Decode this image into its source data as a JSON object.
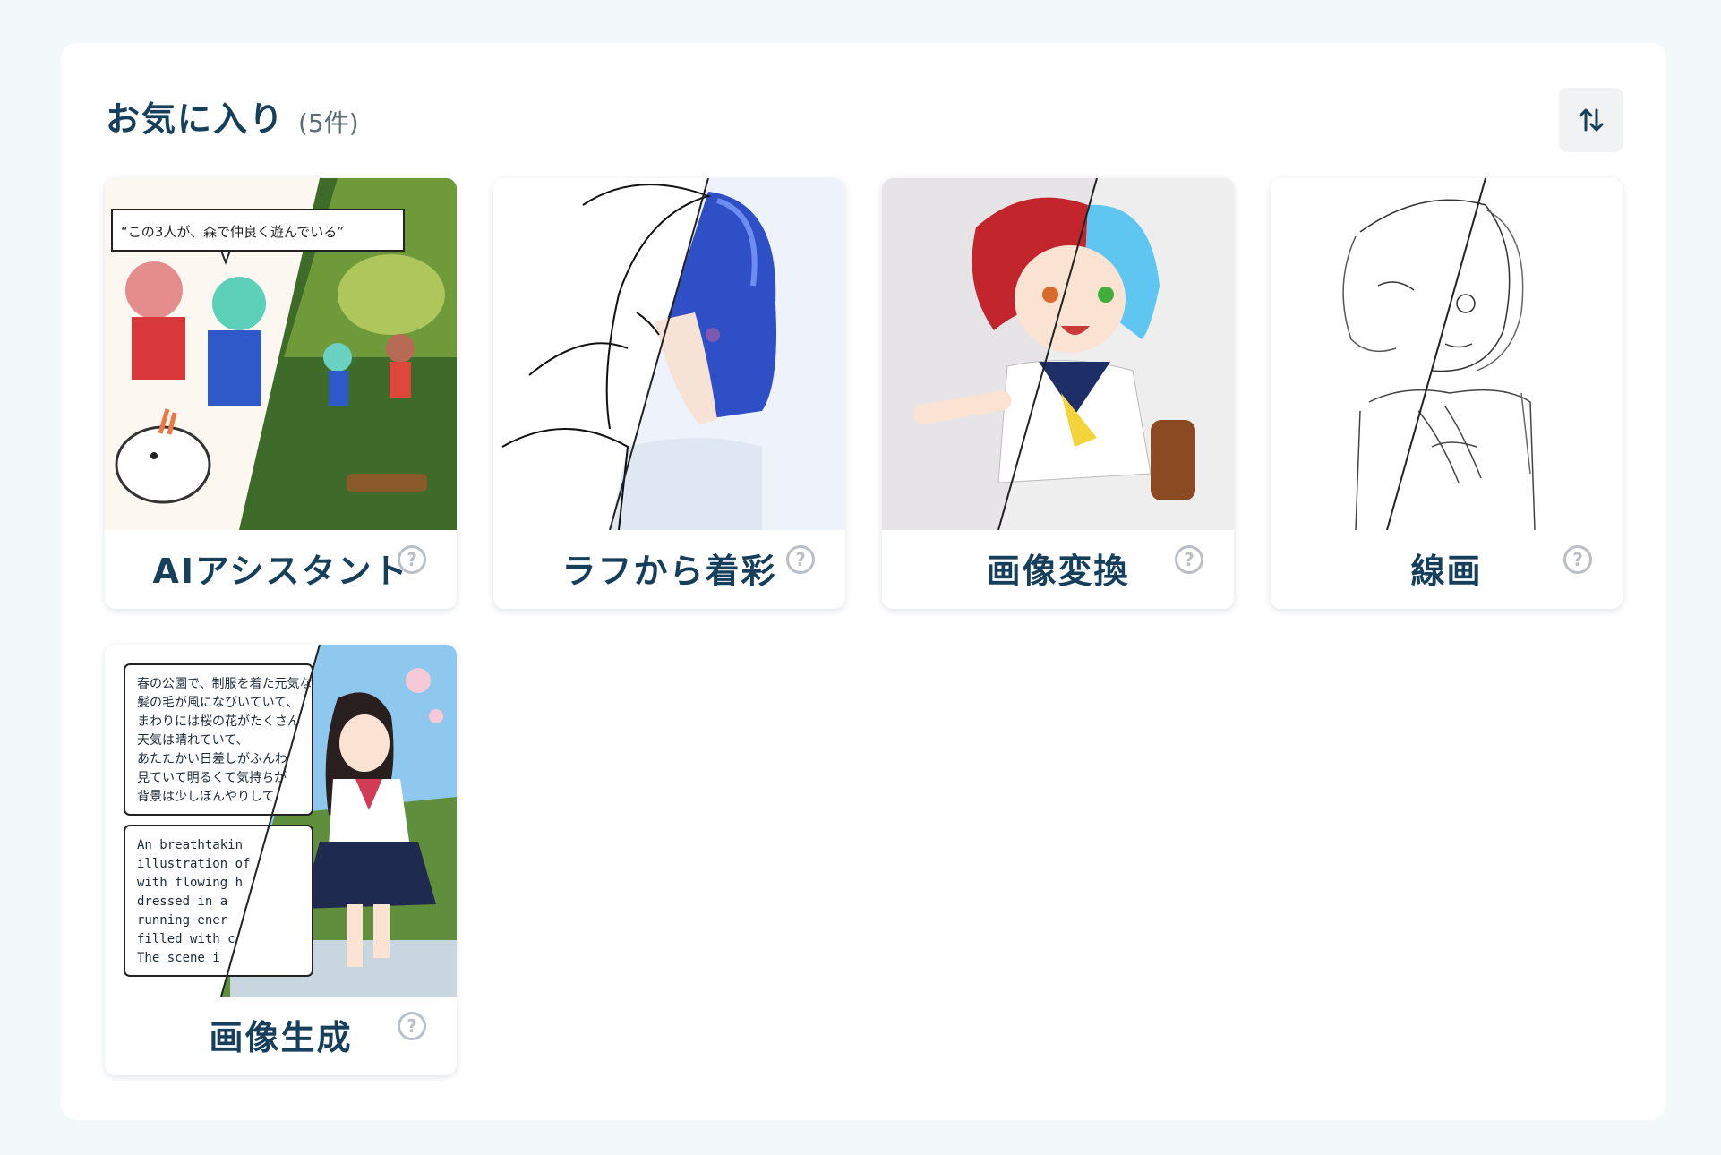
{
  "header": {
    "title": "お気に入り",
    "count": "(5件)"
  },
  "cards": [
    {
      "label": "AIアシスタント",
      "bubble": "“この3人が、森で仲良く遊んでいる”"
    },
    {
      "label": "ラフから着彩"
    },
    {
      "label": "画像変換"
    },
    {
      "label": "線画"
    },
    {
      "label": "画像生成",
      "prompt_ja": [
        "春の公園で、制服を着た元気な",
        "髪の毛が風になびいていて、",
        "まわりには桜の花がたくさん",
        "天気は晴れていて、",
        "あたたかい日差しがふんわ",
        "見ていて明るくて気持ちが",
        "背景は少しぼんやりして"
      ],
      "prompt_en": [
        "An breathtakin",
        "illustration of",
        "with flowing h",
        "dressed in a",
        "running ener",
        "filled with c",
        "The scene i"
      ]
    }
  ],
  "help_glyph": "?",
  "colors": {
    "title": "#163f5c",
    "background": "#f3f8fb",
    "panel": "#ffffff",
    "help": "#b9bfc5"
  }
}
